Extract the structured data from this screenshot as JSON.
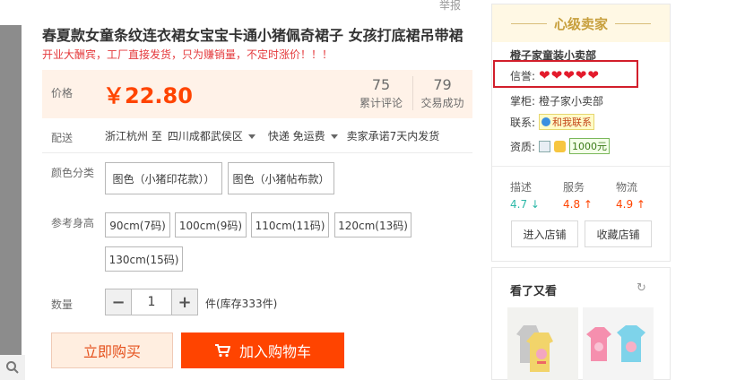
{
  "report_label": "举报",
  "product": {
    "title": "春夏款女童条纹连衣裙女宝宝卡通小猪佩奇裙子 女孩打底裙吊带裙",
    "subtitle": "开业大酬宾，工厂直接发货，只为赚销量，不定时涨价！！！"
  },
  "price": {
    "label": "价格",
    "value": "￥22.80",
    "reviews_count": "75",
    "reviews_label": "累计评论",
    "trades_count": "79",
    "trades_label": "交易成功"
  },
  "delivery": {
    "label": "配送",
    "from": "浙江杭州 至",
    "to": "四川成都武侯区",
    "shipping": "快递 免运费",
    "promise": "卖家承诺7天内发货"
  },
  "color": {
    "label": "颜色分类",
    "options": [
      "图色（小猪印花款））",
      "图色（小猪帖布款）"
    ]
  },
  "size": {
    "label": "参考身高",
    "options": [
      "90cm(7码)",
      "100cm(9码)",
      "110cm(11码)",
      "120cm(13码)",
      "130cm(15码)"
    ]
  },
  "quantity": {
    "label": "数量",
    "minus": "−",
    "value": "1",
    "plus": "+",
    "stock": "件(库存333件)"
  },
  "actions": {
    "buy": "立即购买",
    "cart": "加入购物车"
  },
  "seller": {
    "header": "心级卖家",
    "shop_name": "橙子家童装小卖部",
    "reputation_label": "信誉:",
    "hearts": 5,
    "manager_label": "掌柜:",
    "manager": "橙子家小卖部",
    "contact_label": "联系:",
    "contact_text": "和我联系",
    "qualification_label": "资质:",
    "bond": "1000元",
    "scores": [
      {
        "label": "描述",
        "value": "4.7",
        "trend": "down"
      },
      {
        "label": "服务",
        "value": "4.8",
        "trend": "up"
      },
      {
        "label": "物流",
        "value": "4.9",
        "trend": "up"
      }
    ],
    "enter_shop": "进入店铺",
    "fav_shop": "收藏店铺"
  },
  "also_viewed": {
    "title": "看了又看",
    "refresh_icon": "↻"
  },
  "colors": {
    "accent": "#ff4400",
    "price_bg": "#fff2e8",
    "seller_gold": "#c79f3c",
    "highlight_box": "#d21e2b"
  }
}
